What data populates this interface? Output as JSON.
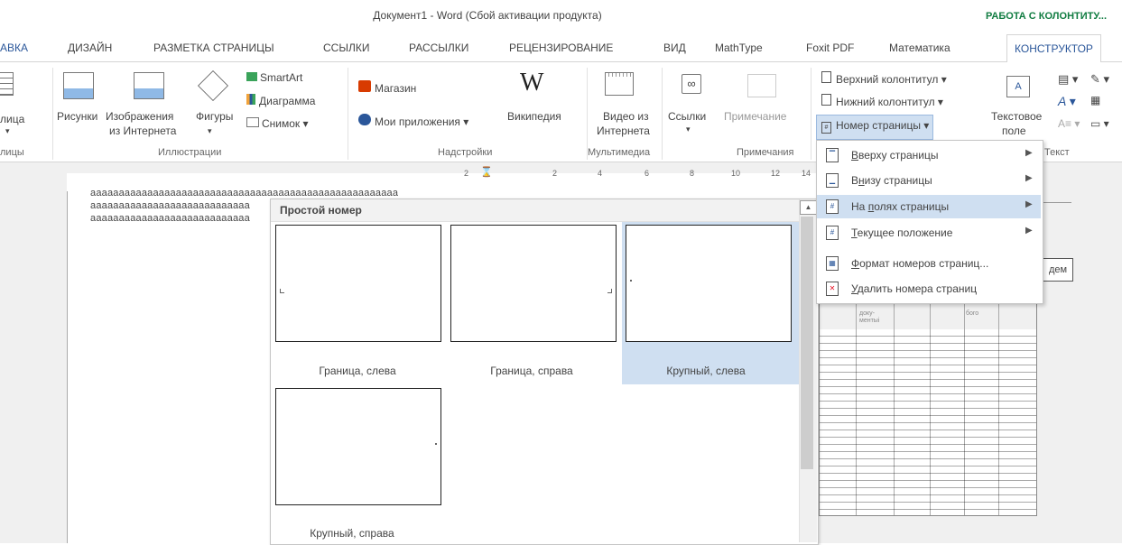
{
  "window": {
    "title": "Документ1 - Word (Сбой активации продукта)",
    "context_tab_header": "РАБОТА С КОЛОНТИТУ..."
  },
  "tabs": [
    "АВКА",
    "ДИЗАЙН",
    "РАЗМЕТКА СТРАНИЦЫ",
    "ССЫЛКИ",
    "РАССЫЛКИ",
    "РЕЦЕНЗИРОВАНИЕ",
    "ВИД",
    "MathType",
    "Foxit PDF",
    "Математика",
    "КОНСТРУКТОР"
  ],
  "ribbon": {
    "table_label": "лица",
    "table_group": "лицы",
    "pictures": "Рисунки",
    "online_pictures_1": "Изображения",
    "online_pictures_2": "из Интернета",
    "shapes": "Фигуры",
    "smartart": "SmartArt",
    "chart": "Диаграмма",
    "screenshot": "Снимок",
    "illustrations_group": "Иллюстрации",
    "store": "Магазин",
    "my_apps": "Мои приложения",
    "wikipedia": "Википедия",
    "addins_group": "Надстройки",
    "online_video_1": "Видео из",
    "online_video_2": "Интернета",
    "media_group": "Мультимедиа",
    "links": "Ссылки",
    "comment": "Примечание",
    "comments_group": "Примечания",
    "header": "Верхний колонтитул",
    "footer": "Нижний колонтитул",
    "page_number": "Номер страницы",
    "text_box_1": "Текстовое",
    "text_box_2": "поле",
    "text_group": "Текст",
    "ruler": [
      "2",
      "2",
      "4",
      "6",
      "8",
      "10",
      "12",
      "14"
    ]
  },
  "document": {
    "lines": [
      "аааааааааааааааааааааааааааааааааааааааааааааааааааааа",
      "аааааааааааааааааааааааааааа",
      "аааааааааааааааааааааааааааа"
    ],
    "right_button": "дем"
  },
  "gallery": {
    "header": "Простой номер",
    "items": [
      "Граница, слева",
      "Граница, справа",
      "Крупный, слева",
      "Крупный, справа"
    ]
  },
  "menu": {
    "items": [
      {
        "label": "Вверху страницы",
        "accel": "В",
        "rest": "верху страницы",
        "submenu": true
      },
      {
        "label": "Внизу страницы",
        "accel": "н",
        "pre": "В",
        "rest": "изу страницы",
        "submenu": true
      },
      {
        "label": "На полях страницы",
        "pre": "На ",
        "accel": "п",
        "rest": "олях страницы",
        "submenu": true
      },
      {
        "label": "Текущее положение",
        "accel": "Т",
        "rest": "екущее положение",
        "submenu": true
      },
      {
        "label": "Формат номеров страниц...",
        "accel": "Ф",
        "rest": "ормат номеров страниц...",
        "submenu": false
      },
      {
        "label": "Удалить номера страниц",
        "accel": "У",
        "rest": "далить номера страниц",
        "submenu": false
      }
    ]
  },
  "table_preview": {
    "header_cells": [
      "доку-",
      "ментыі",
      "бого"
    ]
  }
}
